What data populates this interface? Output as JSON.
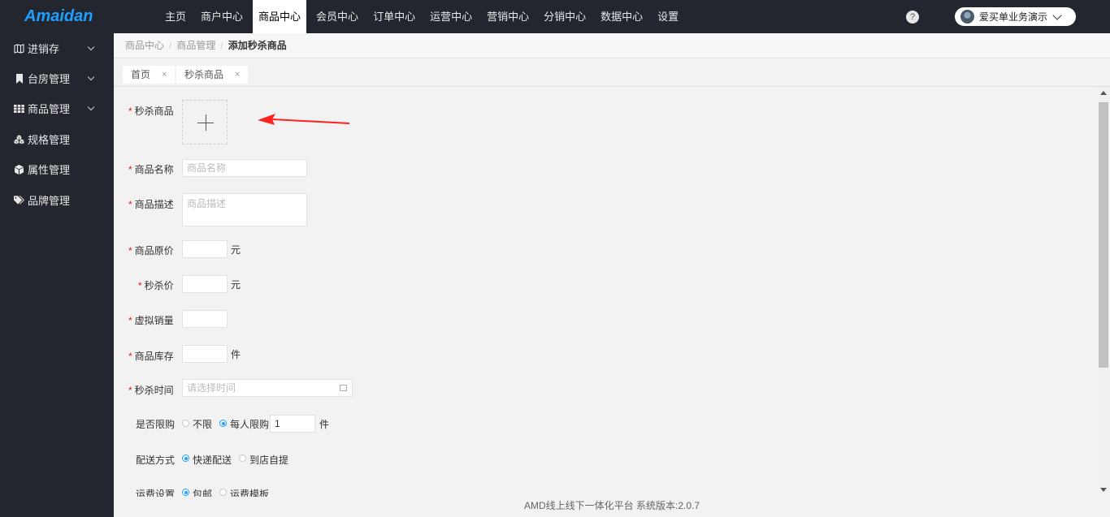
{
  "app": {
    "logo": "Amaidan"
  },
  "topnav": {
    "items": [
      "主页",
      "商户中心",
      "商品中心",
      "会员中心",
      "订单中心",
      "运营中心",
      "营销中心",
      "分销中心",
      "数据中心",
      "设置"
    ],
    "active_index": 2
  },
  "header": {
    "help": "?",
    "user_name": "爱买单业务演示"
  },
  "sidebar": {
    "items": [
      {
        "label": "进销存",
        "icon": "map-icon",
        "expandable": true
      },
      {
        "label": "台房管理",
        "icon": "bookmark-icon",
        "expandable": true
      },
      {
        "label": "商品管理",
        "icon": "grid-icon",
        "expandable": true
      },
      {
        "label": "规格管理",
        "icon": "cubes-icon",
        "expandable": false
      },
      {
        "label": "属性管理",
        "icon": "cube-icon",
        "expandable": false
      },
      {
        "label": "品牌管理",
        "icon": "tags-icon",
        "expandable": false
      }
    ]
  },
  "breadcrumb": {
    "items": [
      "商品中心",
      "商品管理"
    ],
    "current": "添加秒杀商品",
    "separator": "/"
  },
  "tabs": [
    {
      "label": "首页",
      "close": "×"
    },
    {
      "label": "秒杀商品",
      "close": "×"
    }
  ],
  "form": {
    "product": {
      "label": "秒杀商品",
      "required": "*"
    },
    "name": {
      "label": "商品名称",
      "required": "*",
      "placeholder": "商品名称"
    },
    "desc": {
      "label": "商品描述",
      "required": "*",
      "placeholder": "商品描述"
    },
    "original_price": {
      "label": "商品原价",
      "required": "*",
      "unit": "元"
    },
    "seckill_price": {
      "label": "秒杀价",
      "required": "*",
      "unit": "元"
    },
    "virtual_sales": {
      "label": "虚拟销量",
      "required": "*"
    },
    "stock": {
      "label": "商品库存",
      "required": "*",
      "unit": "件"
    },
    "time": {
      "label": "秒杀时间",
      "required": "*",
      "placeholder": "请选择时间"
    },
    "limit": {
      "label": "是否限购",
      "options": [
        "不限",
        "每人限购"
      ],
      "selected_index": 1,
      "value": "1",
      "unit": "件"
    },
    "delivery": {
      "label": "配送方式",
      "options": [
        "快递配送",
        "到店自提"
      ],
      "selected_index": 0
    },
    "shipping": {
      "label": "运费设置",
      "options": [
        "包邮",
        "运费模板"
      ],
      "selected_index": 0
    }
  },
  "footer": {
    "text": "AMD线上线下一体化平台 系统版本:2.0.7"
  },
  "colors": {
    "accent": "#1e9fff",
    "topbar": "#23262e",
    "required": "#e02020",
    "arrow": "#ff2020"
  }
}
